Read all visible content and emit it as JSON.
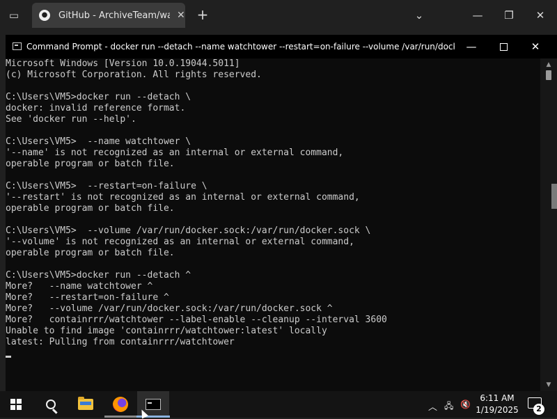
{
  "browser": {
    "tab_title": "GitHub - ArchiveTeam/warrior-",
    "tab_close": "✕",
    "new_tab": "+",
    "tab_list": "⌄",
    "minimize": "—",
    "restore": "❐",
    "close": "✕"
  },
  "cmd_window": {
    "title": "Command Prompt - docker  run --detach  --name watchtower  --restart=on-failure  --volume /var/run/docker.s...",
    "minimize": "—",
    "close": "✕",
    "console_lines": [
      "Microsoft Windows [Version 10.0.19044.5011]",
      "(c) Microsoft Corporation. All rights reserved.",
      "",
      "C:\\Users\\VM5>docker run --detach \\",
      "docker: invalid reference format.",
      "See 'docker run --help'.",
      "",
      "C:\\Users\\VM5>  --name watchtower \\",
      "'--name' is not recognized as an internal or external command,",
      "operable program or batch file.",
      "",
      "C:\\Users\\VM5>  --restart=on-failure \\",
      "'--restart' is not recognized as an internal or external command,",
      "operable program or batch file.",
      "",
      "C:\\Users\\VM5>  --volume /var/run/docker.sock:/var/run/docker.sock \\",
      "'--volume' is not recognized as an internal or external command,",
      "operable program or batch file.",
      "",
      "C:\\Users\\VM5>docker run --detach ^",
      "More?   --name watchtower ^",
      "More?   --restart=on-failure ^",
      "More?   --volume /var/run/docker.sock:/var/run/docker.sock ^",
      "More?   containrrr/watchtower --label-enable --cleanup --interval 3600",
      "Unable to find image 'containrrr/watchtower:latest' locally",
      "latest: Pulling from containrrr/watchtower"
    ],
    "scroll_up": "▲",
    "scroll_down": "▼"
  },
  "taskbar": {
    "time": "6:11 AM",
    "date": "1/19/2025",
    "tray_chevron": "︿",
    "notification_count": "2"
  },
  "colors": {
    "console_bg": "#0c0c0c",
    "console_text": "#cccccc",
    "taskbar_bg": "#141414",
    "active_indicator": "#8cb4e0"
  }
}
